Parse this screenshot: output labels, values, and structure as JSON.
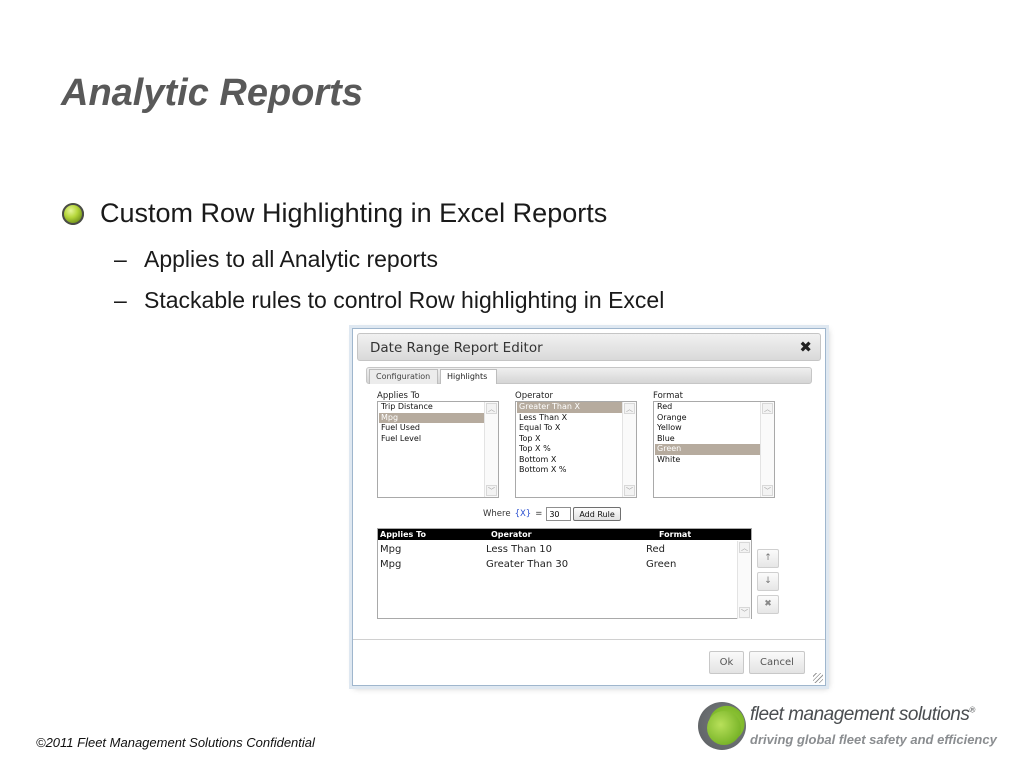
{
  "slide": {
    "title": "Analytic Reports",
    "bullet_main": "Custom Row Highlighting in Excel Reports",
    "sub_bullets": [
      "Applies to all Analytic reports",
      "Stackable rules to control Row highlighting in Excel"
    ],
    "dash": "–"
  },
  "dialog": {
    "title": "Date Range Report Editor",
    "close_glyph": "✖",
    "tabs": [
      {
        "label": "Configuration",
        "active": false
      },
      {
        "label": "Highlights",
        "active": true
      }
    ],
    "applies_to": {
      "label": "Applies To",
      "options": [
        "Trip Distance",
        "Mpg",
        "Fuel Used",
        "Fuel Level"
      ],
      "selected": "Mpg"
    },
    "operator": {
      "label": "Operator",
      "options": [
        "Greater Than X",
        "Less Than X",
        "Equal To X",
        "Top X",
        "Top X %",
        "Bottom X",
        "Bottom X %"
      ],
      "selected": "Greater Than X"
    },
    "format": {
      "label": "Format",
      "options": [
        "Red",
        "Orange",
        "Yellow",
        "Blue",
        "Green",
        "White"
      ],
      "selected": "Green"
    },
    "where": {
      "prefix": "Where",
      "variable": "{X}",
      "equals": "=",
      "value": "30",
      "add_rule_label": "Add Rule"
    },
    "rules_table": {
      "columns": [
        "Applies To",
        "Operator",
        "Format"
      ],
      "rows": [
        {
          "applies_to": "Mpg",
          "operator": "Less Than 10",
          "format": "Red"
        },
        {
          "applies_to": "Mpg",
          "operator": "Greater Than 30",
          "format": "Green"
        }
      ]
    },
    "side_buttons": {
      "up": "↑",
      "down": "↓",
      "delete": "✖"
    },
    "scroll_glyphs": {
      "up": "︿",
      "down": "﹀"
    },
    "ok_label": "Ok",
    "cancel_label": "Cancel"
  },
  "footer": {
    "copyright": "©2011 Fleet Management Solutions Confidential",
    "logo_name": "fleet management solutions",
    "logo_reg": "®",
    "logo_tagline": "driving global fleet safety and efficiency"
  },
  "colors": {
    "title": "#595959",
    "selection": "#b6ab9e",
    "table_header": "#000000",
    "brand_green": "#7eb82b",
    "link_blue": "#2a4fd0"
  }
}
